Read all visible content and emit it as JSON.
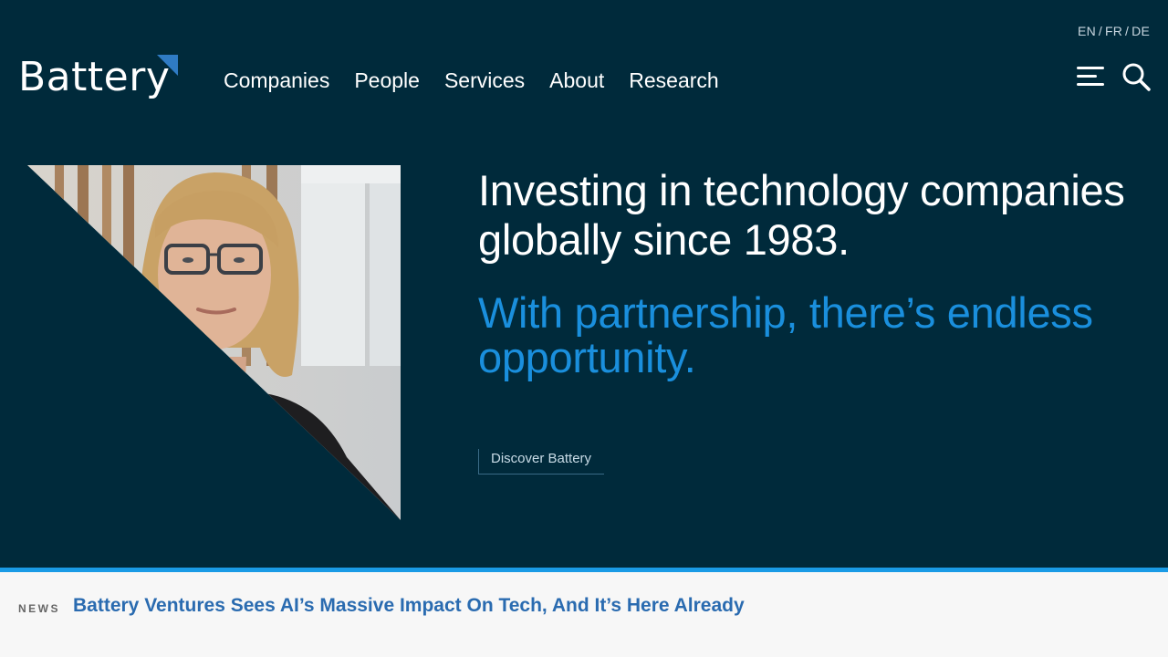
{
  "languages": [
    "EN",
    "FR",
    "DE"
  ],
  "logo": {
    "text": "Battery"
  },
  "nav": {
    "items": [
      "Companies",
      "People",
      "Services",
      "About",
      "Research"
    ]
  },
  "icons": {
    "menu": "menu-icon",
    "search": "search-icon"
  },
  "hero": {
    "headline": "Investing in technology companies globally since 1983.",
    "subhead": "With partnership, there’s endless opportunity.",
    "cta_label": "Discover Battery"
  },
  "news": {
    "label": "NEWS",
    "title": "Battery Ventures Sees AI’s Massive Impact On Tech, And It’s Here Already"
  },
  "colors": {
    "hero_bg": "#002a3b",
    "accent_blue": "#1a8fdd",
    "stripe": "#1a9be6",
    "news_link": "#2a6bb0"
  }
}
